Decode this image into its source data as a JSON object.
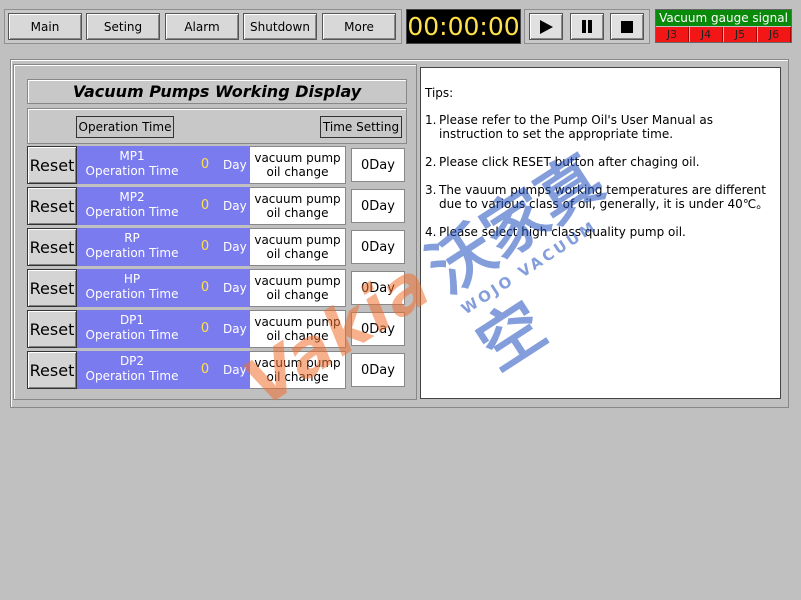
{
  "nav": {
    "buttons": [
      "Main",
      "Seting",
      "Alarm",
      "Shutdown",
      "More"
    ]
  },
  "clock": {
    "time": "00:00:00"
  },
  "controls": {
    "play_icon": "play-icon",
    "pause_icon": "pause-icon",
    "stop_icon": "stop-icon"
  },
  "gauge": {
    "title": "Vacuum gauge signal",
    "channels": [
      "J3",
      "J4",
      "J5",
      "J6"
    ],
    "title_color": "#0a8a0a",
    "channel_color": "#f21616"
  },
  "panel": {
    "title": "Vacuum Pumps Working Display",
    "operation_time_label": "Operation Time",
    "time_setting_label": "Time Setting"
  },
  "pumps": [
    {
      "reset": "Reset",
      "name": "MP1",
      "sub": "Operation Time",
      "value": "0",
      "unit": "Day",
      "oil1": "vacuum pump",
      "oil2": "oil change",
      "setting": "0Day"
    },
    {
      "reset": "Reset",
      "name": "MP2",
      "sub": "Operation Time",
      "value": "0",
      "unit": "Day",
      "oil1": "vacuum pump",
      "oil2": "oil change",
      "setting": "0Day"
    },
    {
      "reset": "Reset",
      "name": "RP",
      "sub": "Operation Time",
      "value": "0",
      "unit": "Day",
      "oil1": "vacuum pump",
      "oil2": "oil change",
      "setting": "0Day"
    },
    {
      "reset": "Reset",
      "name": "HP",
      "sub": "Operation Time",
      "value": "0",
      "unit": "Day",
      "oil1": "vacuum pump",
      "oil2": "oil change",
      "setting": "0Day"
    },
    {
      "reset": "Reset",
      "name": "DP1",
      "sub": "Operation Time",
      "value": "0",
      "unit": "Day",
      "oil1": "vacuum pump",
      "oil2": "oil change",
      "setting": "0Day"
    },
    {
      "reset": "Reset",
      "name": "DP2",
      "sub": "Operation Time",
      "value": "0",
      "unit": "Day",
      "oil1": "vacuum pump",
      "oil2": "oil change",
      "setting": "0Day"
    }
  ],
  "tips": {
    "title": "Tips:",
    "items": [
      {
        "num": "1.",
        "text": "Please refer to the Pump Oil's User Manual as instruction  to set the appropriate time."
      },
      {
        "num": "2.",
        "text": "Please click RESET button after chaging oil."
      },
      {
        "num": "3.",
        "text": "The vauum pumps working temperatures are different due to various class of oil, generally, it is under 40℃。"
      },
      {
        "num": "4.",
        "text": "Please select high class quality pump oil."
      }
    ]
  },
  "watermark": {
    "logo": "Vakia",
    "cjk": "沃家真空",
    "sub": "WOJO VACUUM"
  },
  "colors": {
    "background": "#c0c0c0",
    "pump_bar": "#7b7bf0",
    "clock_text": "#ffe14a"
  }
}
